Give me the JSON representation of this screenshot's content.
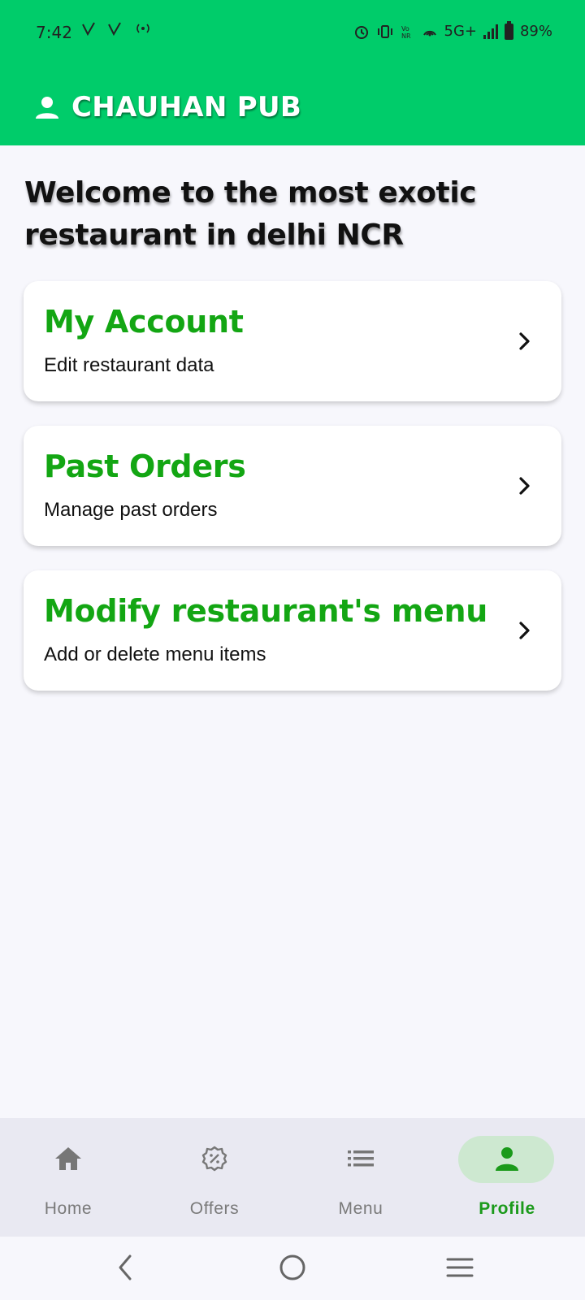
{
  "status_bar": {
    "time": "7:42",
    "network": "5G+",
    "battery": "89%"
  },
  "app_bar": {
    "title": "CHAUHAN PUB",
    "color": "#00cc6a"
  },
  "welcome_text": "Welcome to the most exotic restaurant in delhi NCR",
  "cards": [
    {
      "title": "My Account",
      "subtitle": "Edit restaurant data"
    },
    {
      "title": "Past Orders",
      "subtitle": "Manage past orders"
    },
    {
      "title": "Modify restaurant's menu",
      "subtitle": "Add or delete menu items"
    }
  ],
  "bottom_nav": {
    "items": [
      {
        "label": "Home",
        "icon": "home-icon"
      },
      {
        "label": "Offers",
        "icon": "offers-icon"
      },
      {
        "label": "Menu",
        "icon": "menu-list-icon"
      },
      {
        "label": "Profile",
        "icon": "profile-icon"
      }
    ],
    "active": "Profile",
    "accent": "#1b9a1b"
  }
}
